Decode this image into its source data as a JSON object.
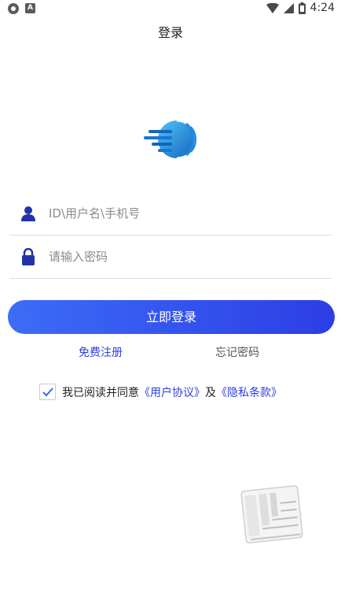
{
  "status_bar": {
    "time": "4:24",
    "notification_icon": "shield-icon",
    "app_icon": "a-icon",
    "wifi_icon": "wifi-icon",
    "signal_icon": "signal-icon",
    "battery_icon": "battery-icon",
    "app_icon_letter": "A"
  },
  "header": {
    "title": "登录"
  },
  "logo": {
    "icon": "globe-logo-icon",
    "colors": [
      "#1a8fe8",
      "#35b6f5",
      "#3d6cf6"
    ]
  },
  "form": {
    "username": {
      "icon": "user-icon",
      "placeholder": "ID\\用户名\\手机号",
      "value": ""
    },
    "password": {
      "icon": "lock-icon",
      "placeholder": "请输入密码",
      "value": ""
    },
    "login_button_label": "立即登录"
  },
  "links": {
    "register": "免费注册",
    "forgot": "忘记密码"
  },
  "agreement": {
    "checked": true,
    "prefix": "我已阅读并同意",
    "user_agreement": "《用户协议》",
    "connector": "及",
    "privacy": "《隐私条款》"
  },
  "colors": {
    "accent": "#2b3fe0",
    "button_gradient_start": "#3d6cf6",
    "button_gradient_end": "#2c3ee6"
  }
}
